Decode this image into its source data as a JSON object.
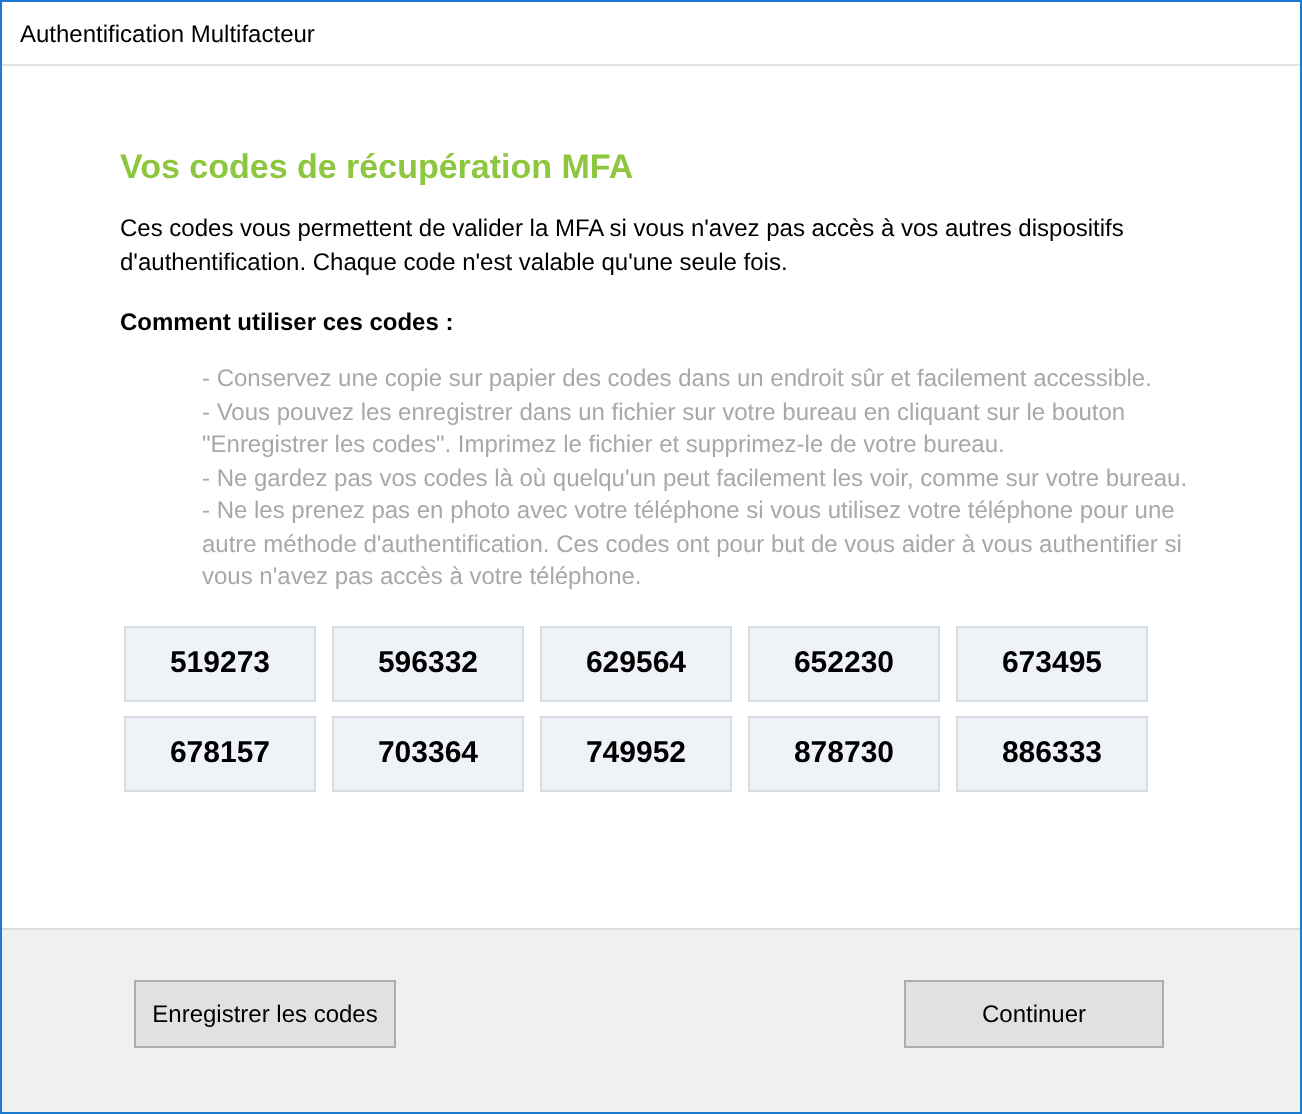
{
  "window": {
    "title": "Authentification Multifacteur"
  },
  "heading": "Vos codes de récupération MFA",
  "intro": "Ces codes vous permettent de valider la MFA si vous n'avez pas accès à vos autres dispositifs d'authentification. Chaque code n'est valable qu'une seule fois.",
  "howto_title": "Comment utiliser ces codes :",
  "instructions": [
    "- Conservez une copie sur papier des codes dans un endroit sûr et facilement accessible.",
    "- Vous pouvez les enregistrer dans un fichier sur votre bureau en cliquant sur le bouton \"Enregistrer les codes\". Imprimez le fichier et supprimez-le de votre bureau.",
    "- Ne gardez pas vos codes là où quelqu'un peut facilement les voir, comme sur votre bureau.",
    "- Ne les prenez pas en photo avec votre téléphone si vous utilisez votre téléphone pour une autre méthode d'authentification. Ces codes ont pour but de vous aider à vous authentifier si vous n'avez pas accès à votre téléphone."
  ],
  "codes": [
    "519273",
    "596332",
    "629564",
    "652230",
    "673495",
    "678157",
    "703364",
    "749952",
    "878730",
    "886333"
  ],
  "buttons": {
    "save": "Enregistrer les codes",
    "continue": "Continuer"
  }
}
